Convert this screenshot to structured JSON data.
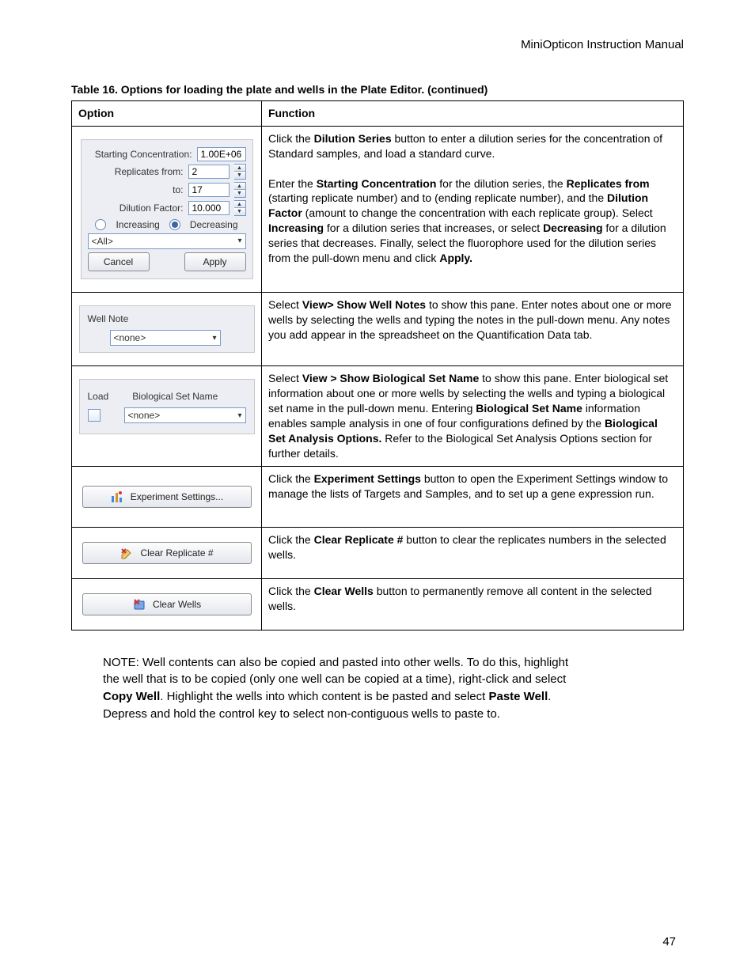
{
  "doc_header": "MiniOpticon Instruction Manual",
  "table_caption": "Table 16. Options for loading the plate and wells in the Plate Editor. (continued)",
  "col1": "Option",
  "col2": "Function",
  "dilution": {
    "starting_label": "Starting Concentration:",
    "starting_value": "1.00E+06",
    "replicates_from_label": "Replicates from:",
    "replicates_from_value": "2",
    "to_label": "to:",
    "to_value": "17",
    "dilution_factor_label": "Dilution Factor:",
    "dilution_factor_value": "10.000",
    "increasing": "Increasing",
    "decreasing": "Decreasing",
    "all": "<All>",
    "cancel": "Cancel",
    "apply": "Apply",
    "function_p1a": "Click the ",
    "function_p1b": "Dilution Series",
    "function_p1c": " button to enter a dilution series for the concentration of Standard samples, and load a standard curve.",
    "function_p2a": "Enter the ",
    "function_p2b": "Starting Concentration",
    "function_p2c": " for the dilution series, the ",
    "function_p2d": "Replicates from",
    "function_p2e": " (starting replicate number) and to (ending replicate number), and the ",
    "function_p2f": "Dilution Factor",
    "function_p2g": " (amount to change the concentration with each replicate group). Select ",
    "function_p2h": "Increasing",
    "function_p2i": " for a dilution series that increases, or select ",
    "function_p2j": "Decreasing",
    "function_p2k": " for a dilution series that decreases. Finally, select the fluorophore used for the dilution series from the pull-down menu and click ",
    "function_p2l": "Apply."
  },
  "wellnote": {
    "label": "Well Note",
    "value": "<none>",
    "fa": "Select ",
    "fb": "View> Show Well Notes",
    "fc": " to show this pane. Enter notes about one or more wells by selecting the wells and typing the notes in the pull-down menu. Any notes you add appear in the spreadsheet on the Quantification Data tab."
  },
  "bio": {
    "load": "Load",
    "label": "Biological Set Name",
    "value": "<none>",
    "fa": "Select ",
    "fb": "View > Show Biological Set Name",
    "fc": " to show this pane. Enter biological set information about one or more wells by selecting the wells and typing a biological set name in the pull-down menu. Entering ",
    "fd": "Biological Set Name",
    "fe": " information enables sample analysis in one of four configurations defined by the ",
    "ff": "Biological Set Analysis Options.",
    "fg": " Refer to the Biological Set Analysis Options section for further details."
  },
  "exp": {
    "btn": "Experiment Settings...",
    "fa": "Click the ",
    "fb": "Experiment Settings",
    "fc": " button to open the Experiment Settings window to manage the lists of Targets and Samples, and to set up a gene expression run."
  },
  "clr_rep": {
    "btn": "Clear Replicate #",
    "fa": "Click the ",
    "fb": "Clear Replicate #",
    "fc": " button to clear the replicates numbers in the selected wells."
  },
  "clr_wells": {
    "btn": "Clear Wells",
    "fa": "Click the ",
    "fb": "Clear Wells",
    "fc": " button to permanently remove all content in the selected wells."
  },
  "note": {
    "a": "NOTE: Well contents can also be copied and pasted into other wells. To do this, highlight the well that is to be copied (only one well can be copied at a time), right-click and select ",
    "b": "Copy Well",
    "c": ". Highlight the wells into which content is be pasted and select ",
    "d": "Paste Well",
    "e": ". Depress and hold the control key to select non-contiguous wells to paste to."
  },
  "page": "47"
}
